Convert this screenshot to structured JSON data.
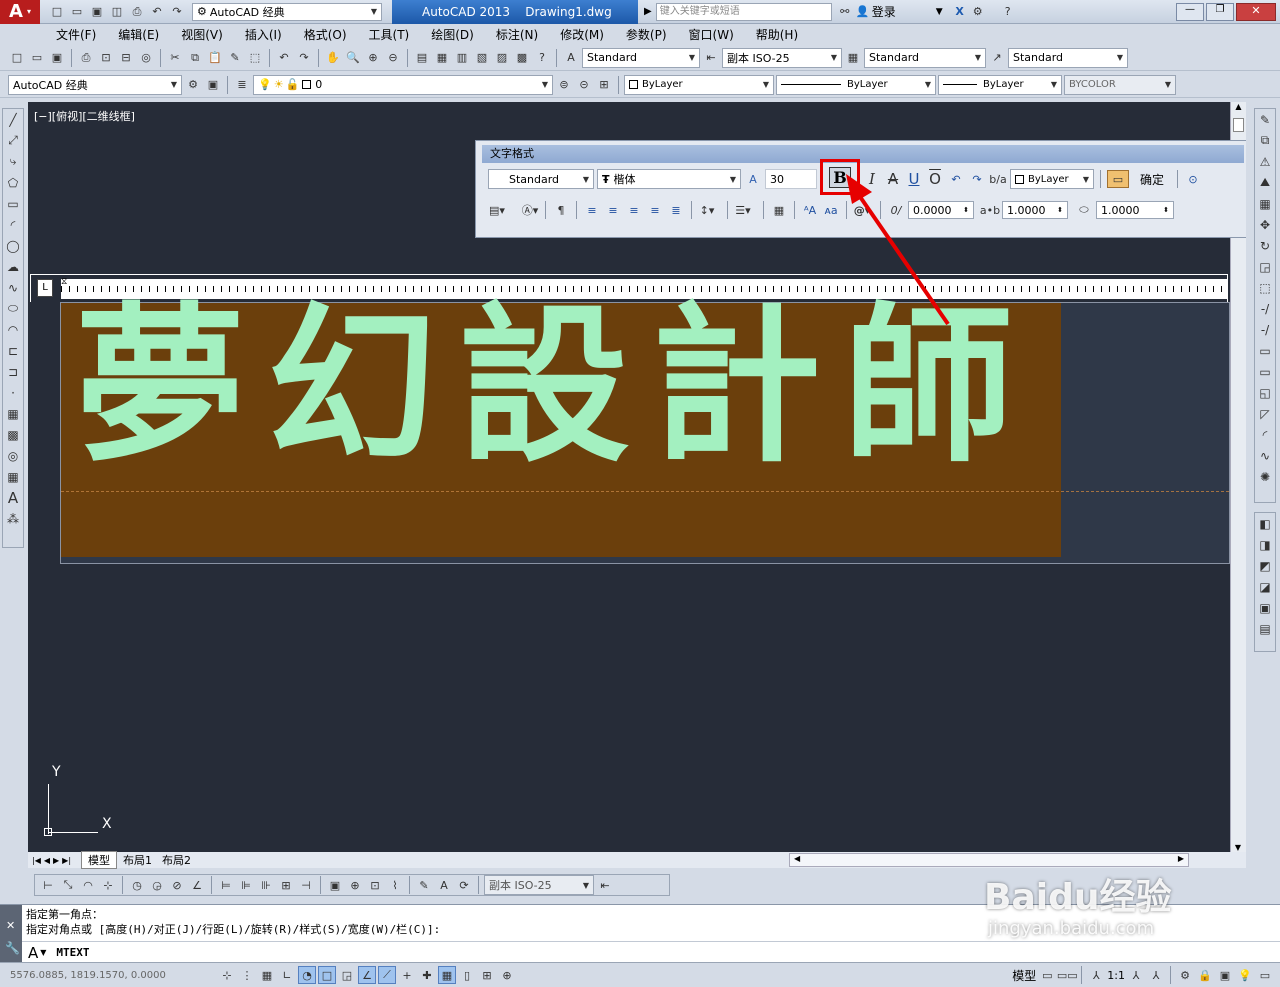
{
  "titlebar": {
    "workspace": "AutoCAD 经典",
    "title": "AutoCAD 2013    Drawing1.dwg",
    "search_placeholder": "键入关键字或短语",
    "login": "登录"
  },
  "menu": [
    "文件(F)",
    "编辑(E)",
    "视图(V)",
    "插入(I)",
    "格式(O)",
    "工具(T)",
    "绘图(D)",
    "标注(N)",
    "修改(M)",
    "参数(P)",
    "窗口(W)",
    "帮助(H)"
  ],
  "styles": {
    "text_style": "Standard",
    "dim_style": "副本 ISO-25",
    "table_style": "Standard",
    "mleader_style": "Standard"
  },
  "props": {
    "workspace": "AutoCAD 经典",
    "layer": "0",
    "color": "ByLayer",
    "linetype": "ByLayer",
    "lineweight": "ByLayer",
    "plotstyle": "BYCOLOR"
  },
  "viewport_label": "[−][俯视][二维线框]",
  "text_format": {
    "title": "文字格式",
    "style": "Standard",
    "font": "楷体",
    "height": "30",
    "color": "ByLayer",
    "ok": "确定",
    "oblique": "0.0000",
    "tracking": "1.0000",
    "width_factor": "1.0000"
  },
  "mtext": {
    "content": "夢幻設計師"
  },
  "tabs": [
    "模型",
    "布局1",
    "布局2"
  ],
  "dim_style_small": "副本 ISO-25",
  "command": {
    "line1": "指定第一角点：",
    "line2": "指定对角点或 [高度(H)/对正(J)/行距(L)/旋转(R)/样式(S)/宽度(W)/栏(C)]:",
    "input": "MTEXT"
  },
  "status": {
    "coords": "5576.0885, 1819.1570, 0.0000",
    "model": "模型",
    "scale": "1:1"
  },
  "ucs": {
    "y": "Y",
    "x": "X"
  },
  "watermark": {
    "line1": "Baidu经验",
    "line2": "jingyan.baidu.com"
  },
  "colors": {
    "canvas": "#262c38",
    "mtext_bg": "#6b3f0c",
    "mtext_fg": "#a3f0c0",
    "highlight": "#e60000"
  }
}
